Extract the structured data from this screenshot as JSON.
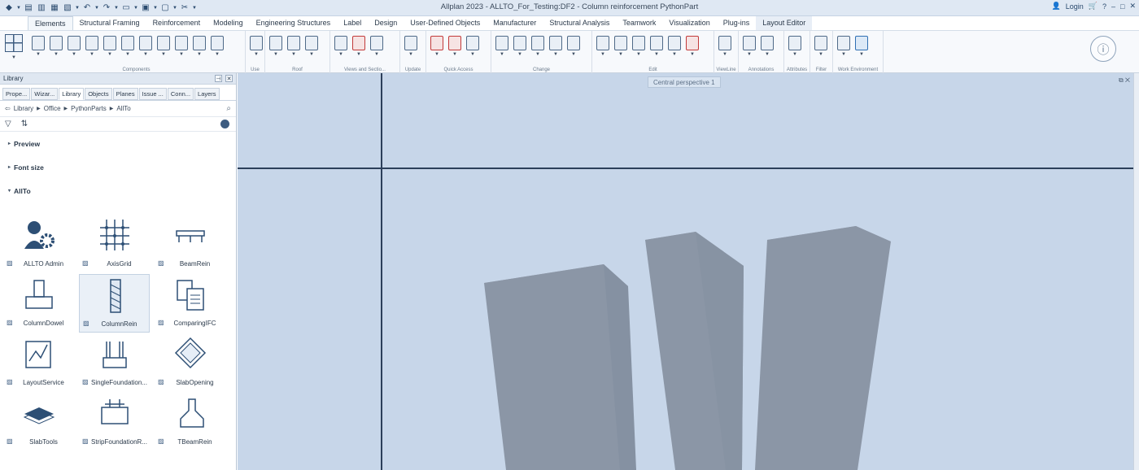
{
  "titlebar": {
    "title": "Allplan 2023 - ALLTO_For_Testing:DF2 - Column reinforcement PythonPart",
    "login": "Login"
  },
  "ribbon": {
    "tabs": [
      "Elements",
      "Structural Framing",
      "Reinforcement",
      "Modeling",
      "Engineering Structures",
      "Label",
      "Design",
      "User-Defined Objects",
      "Manufacturer",
      "Structural Analysis",
      "Teamwork",
      "Visualization",
      "Plug-ins",
      "Layout Editor"
    ],
    "active_tab": "Elements",
    "groups": [
      "Components",
      "Use",
      "Roof",
      "Views and Sectio...",
      "Update",
      "Quick Access",
      "Change",
      "Edit",
      "ViewLine",
      "Annotations",
      "Attributes",
      "Filter",
      "Work Environment"
    ]
  },
  "panel": {
    "title": "Library",
    "tabs": [
      "Prope...",
      "Wizar...",
      "Library",
      "Objects",
      "Planes",
      "Issue ...",
      "Conn...",
      "Layers"
    ],
    "active_tab": "Library",
    "breadcrumb": [
      "Library",
      "Office",
      "PythonParts",
      "AllTo"
    ],
    "sections": [
      "Preview",
      "Font size",
      "AllTo"
    ],
    "items": [
      {
        "label": "ALLTO Admin",
        "icon": "admin-gear-icon"
      },
      {
        "label": "AxisGrid",
        "icon": "axis-grid-icon"
      },
      {
        "label": "BeamRein",
        "icon": "beam-rein-icon"
      },
      {
        "label": "ColumnDowel",
        "icon": "column-dowel-icon"
      },
      {
        "label": "ColumnRein",
        "icon": "column-rein-icon"
      },
      {
        "label": "ComparingIFC",
        "icon": "comparing-ifc-icon"
      },
      {
        "label": "LayoutService",
        "icon": "layout-service-icon"
      },
      {
        "label": "SingleFoundation...",
        "icon": "single-foundation-icon"
      },
      {
        "label": "SlabOpening",
        "icon": "slab-opening-icon"
      },
      {
        "label": "SlabTools",
        "icon": "slab-tools-icon"
      },
      {
        "label": "StripFoundationR...",
        "icon": "strip-foundation-icon"
      },
      {
        "label": "TBeamRein",
        "icon": "tbeam-rein-icon"
      }
    ],
    "selected_item": "ColumnRein"
  },
  "viewport": {
    "label": "Central perspective 1"
  },
  "colors": {
    "viewport_bg": "#c7d6e9",
    "column_fill": "#8b96a6",
    "column_top": "#9aa3b2"
  }
}
